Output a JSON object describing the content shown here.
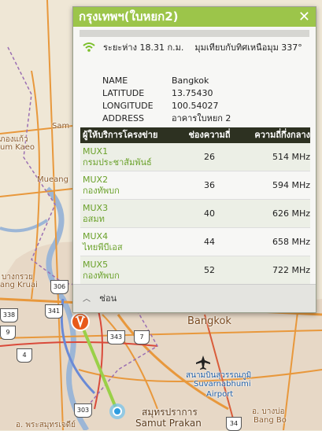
{
  "popup": {
    "title": "กรุงเทพฯ(ใบหยก2)",
    "close_label": "✕",
    "distance_text": "ระยะห่าง 18.31 ก.ม.",
    "bearing_text": "มุมเทียบกับทิศเหนือมุม 337°",
    "info": [
      {
        "key": "NAME",
        "value": "Bangkok"
      },
      {
        "key": "LATITUDE",
        "value": "13.75430"
      },
      {
        "key": "LONGITUDE",
        "value": "100.54027"
      },
      {
        "key": "ADDRESS",
        "value": "อาคารใบหยก 2"
      }
    ],
    "table": {
      "headers": [
        "ผู้ให้บริการโครงข่าย",
        "ช่องความถี่",
        "ความถี่กึ่งกลาง"
      ],
      "rows": [
        {
          "mux": "MUX1",
          "provider": "กรมประชาสัมพันธ์",
          "channel": "26",
          "freq": "514 MHz"
        },
        {
          "mux": "MUX2",
          "provider": "กองทัพบก",
          "channel": "36",
          "freq": "594 MHz"
        },
        {
          "mux": "MUX3",
          "provider": "อสมท",
          "channel": "40",
          "freq": "626 MHz"
        },
        {
          "mux": "MUX4",
          "provider": "ไทยพีบีเอส",
          "channel": "44",
          "freq": "658 MHz"
        },
        {
          "mux": "MUX5",
          "provider": "กองทัพบก",
          "channel": "52",
          "freq": "722 MHz"
        }
      ]
    },
    "collapse_label": "ซ่อน"
  },
  "map": {
    "labels": {
      "kaeo_thai": "ภองแก้ว",
      "kaeo_en": "um Kaeo",
      "sam": "Sam",
      "mueang": "Mueang",
      "bangkruai_thai": "บางกรวย",
      "bangkruai_en": "ang Kruai",
      "bangkok": "Bangkok",
      "airport_thai": "สนามบินสุวรรณภูมิ",
      "airport_en1": "Suvarnabhumi",
      "airport_en2": "Airport",
      "samut_thai": "สมุทรปราการ",
      "samut_en": "Samut Prakan",
      "bangbo_thai": "อ. บางบ่อ",
      "bangbo_en": "Bang Bo",
      "bottom_thai": "อ. พระสมุทรเจดีย์"
    },
    "shields": [
      "306",
      "338",
      "341",
      "343",
      "7",
      "4",
      "303",
      "34",
      "9"
    ]
  }
}
